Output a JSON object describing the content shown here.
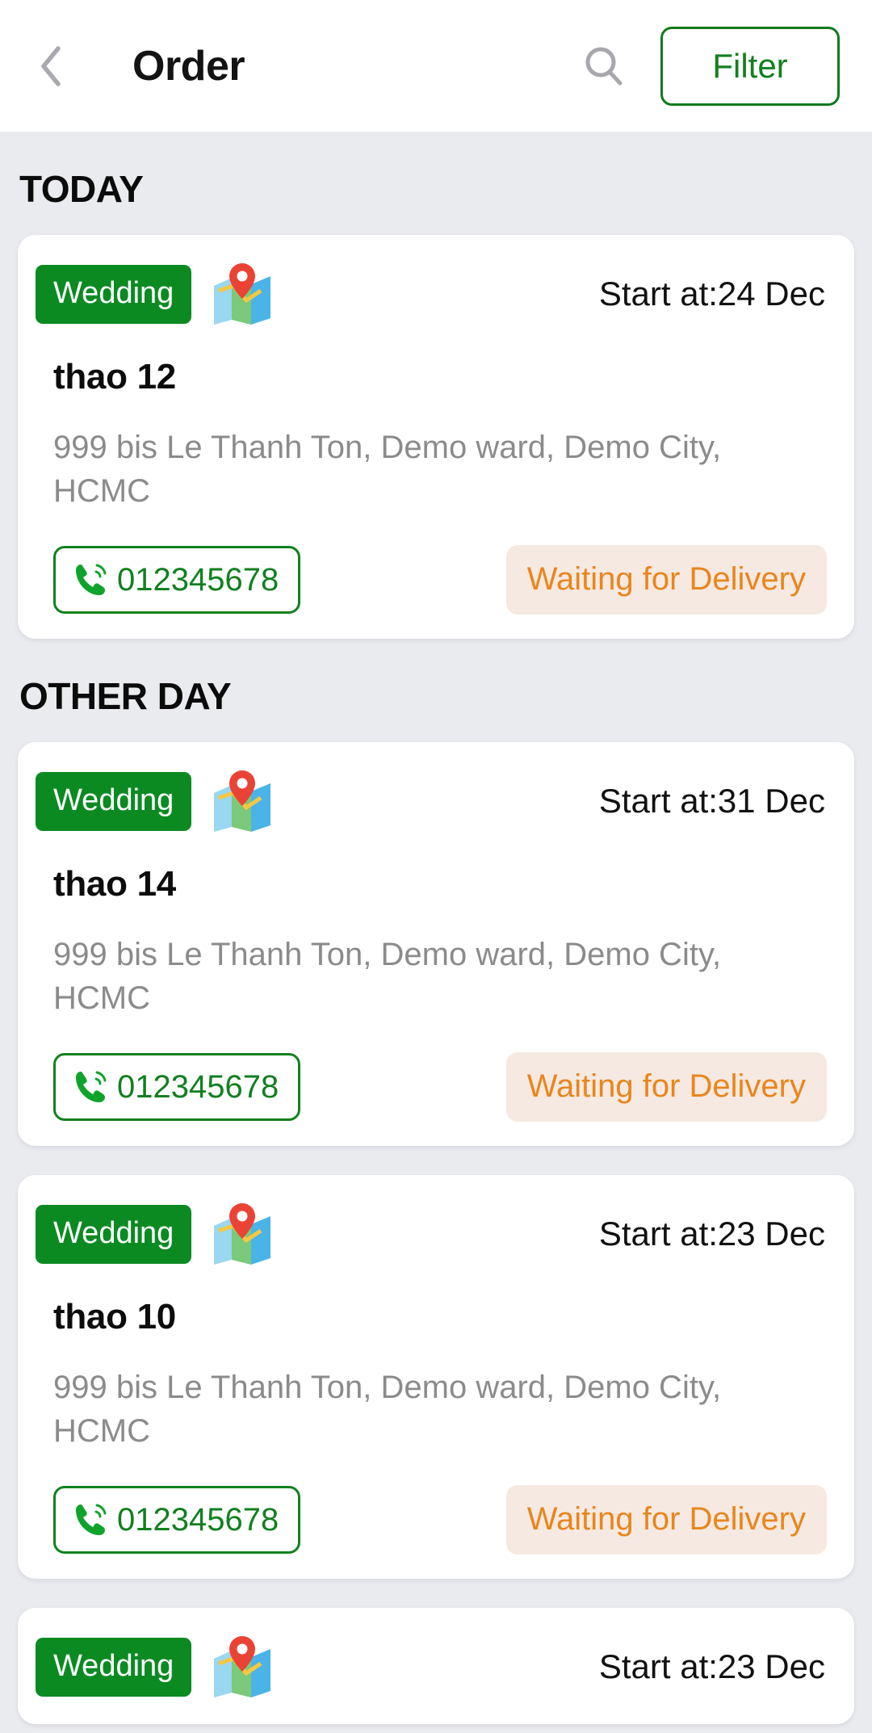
{
  "header": {
    "back_icon": "chevron-left-icon",
    "title": "Order",
    "search_icon": "search-icon",
    "filter_label": "Filter",
    "accent_green": "#12801f"
  },
  "colors": {
    "page_background": "#eaebef",
    "card_background": "#ffffff",
    "badge_green": "#0c8a22",
    "status_orange": "#e8861d",
    "status_bg": "#f6e9e1",
    "address_gray": "#8b8b8b"
  },
  "sections": [
    {
      "title": "TODAY",
      "orders": [
        {
          "type": "Wedding",
          "map_icon": "map-location-icon",
          "start_at": "Start at:24 Dec",
          "customer": "thao 12",
          "address": "999 bis Le Thanh Ton, Demo ward, Demo City, HCMC",
          "phone_icon": "phone-icon",
          "phone": "012345678",
          "status": "Waiting for Delivery"
        }
      ]
    },
    {
      "title": "OTHER DAY",
      "orders": [
        {
          "type": "Wedding",
          "map_icon": "map-location-icon",
          "start_at": "Start at:31 Dec",
          "customer": "thao 14",
          "address": "999 bis Le Thanh Ton, Demo ward, Demo City, HCMC",
          "phone_icon": "phone-icon",
          "phone": "012345678",
          "status": "Waiting for Delivery"
        },
        {
          "type": "Wedding",
          "map_icon": "map-location-icon",
          "start_at": "Start at:23 Dec",
          "customer": "thao 10",
          "address": "999 bis Le Thanh Ton, Demo ward, Demo City, HCMC",
          "phone_icon": "phone-icon",
          "phone": "012345678",
          "status": "Waiting for Delivery"
        },
        {
          "type": "Wedding",
          "map_icon": "map-location-icon",
          "start_at": "Start at:23 Dec",
          "customer": "",
          "address": "",
          "phone_icon": "phone-icon",
          "phone": "",
          "status": ""
        }
      ]
    }
  ]
}
